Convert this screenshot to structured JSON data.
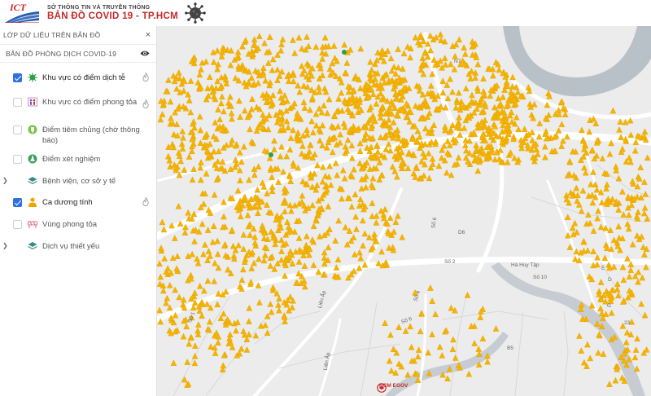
{
  "header": {
    "logo_text": "ICT",
    "org_name": "SỞ THÔNG TIN VÀ TRUYỀN THÔNG",
    "app_title": "BẢN ĐỒ  COVID 19 - TP.HCM"
  },
  "sidebar": {
    "title": "LỚP DỮ LIỆU TRÊN BẢN ĐỒ",
    "close_label": "×",
    "section_title": "BẢN ĐỒ PHÒNG DỊCH COVID-19",
    "layers": [
      {
        "label": "Khu vực có điểm dịch tễ",
        "checked": true,
        "expandable": false,
        "has_flame": true,
        "icon": "virus-green-icon"
      },
      {
        "label": "Khu vực có điểm phong tỏa",
        "checked": false,
        "expandable": false,
        "has_flame": true,
        "icon": "lockdown-people-icon"
      },
      {
        "label": "Điểm tiêm chủng (chờ thông báo)",
        "checked": false,
        "expandable": false,
        "has_flame": false,
        "icon": "vaccine-icon"
      },
      {
        "label": "Điểm xét nghiệm",
        "checked": false,
        "expandable": false,
        "has_flame": false,
        "icon": "test-icon"
      },
      {
        "label": "Bệnh viện, cơ sở y tế",
        "checked": false,
        "expandable": true,
        "has_flame": false,
        "icon": "layers-stack-icon"
      },
      {
        "label": "Ca dương tính",
        "checked": true,
        "expandable": false,
        "has_flame": true,
        "icon": "person-orange-icon"
      },
      {
        "label": "Vùng phong tỏa",
        "checked": false,
        "expandable": false,
        "has_flame": false,
        "icon": "barrier-icon"
      },
      {
        "label": "Dịch vụ thiết yếu",
        "checked": false,
        "expandable": true,
        "has_flame": false,
        "icon": "layers-stack-icon"
      }
    ]
  },
  "map": {
    "street_labels": [
      "N7",
      "D6",
      "Số 2",
      "Hà Huy Tập",
      "Số 10",
      "Số 4",
      "Số 6",
      "Liên Ấp",
      "Liên Ấp",
      "Số 1",
      "B5",
      "Số 6",
      "E",
      "G",
      "D",
      "23"
    ],
    "watermark": "HCM EGOV",
    "colors": {
      "case_marker": "#f4b400",
      "zone_marker": "#2e9e48",
      "land": "#ececec",
      "water": "#b9c1c8",
      "road": "#ffffff"
    }
  }
}
